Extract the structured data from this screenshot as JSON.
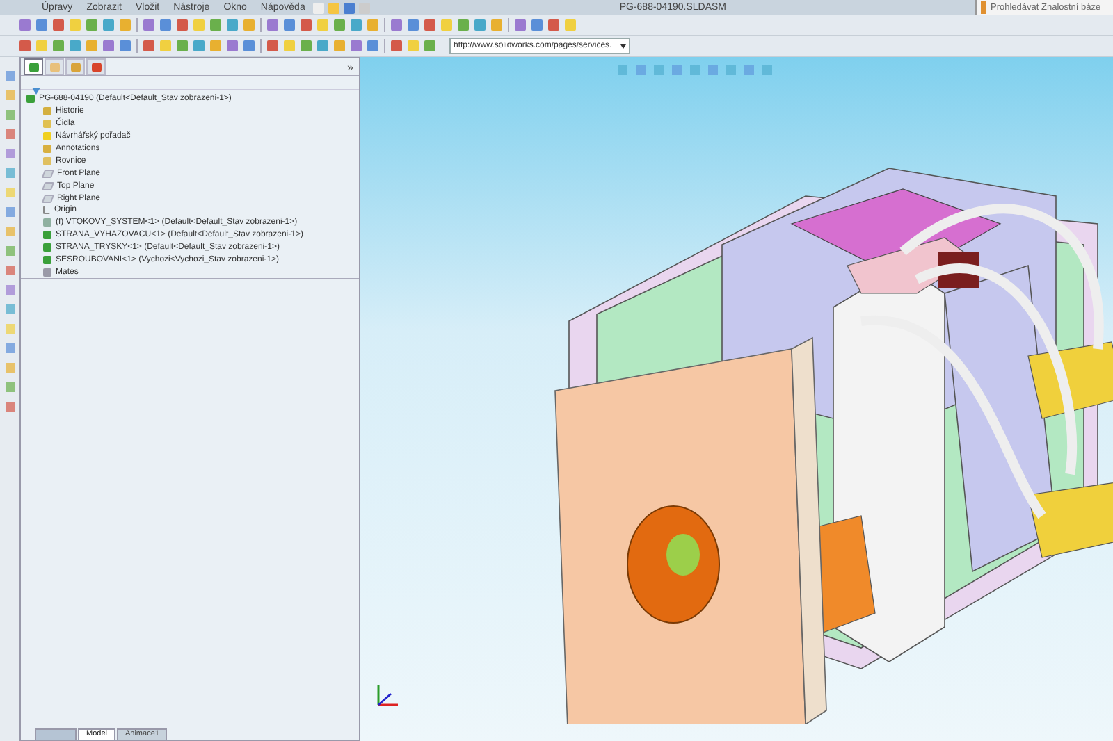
{
  "menu_bar": [
    "Úpravy",
    "Zobrazit",
    "Vložit",
    "Nástroje",
    "Okno",
    "Nápověda"
  ],
  "window": {
    "title": "PG-688-04190.SLDASM"
  },
  "search": {
    "placeholder": "Prohledávat Znalostní báze"
  },
  "address_bar": {
    "value": "http://www.solidworks.com/pages/services."
  },
  "panel_tabs": [
    {
      "kind": "feature",
      "selected": true
    },
    {
      "kind": "property",
      "selected": false
    },
    {
      "kind": "config",
      "selected": false
    },
    {
      "kind": "appearance",
      "selected": false
    }
  ],
  "panel_collapse": "»",
  "tree": {
    "label": "PG-688-04190  (Default<Default_Stav zobrazeni-1>)",
    "kind": "assembly",
    "children": [
      {
        "label": "Historie",
        "kind": "history"
      },
      {
        "label": "Čidla",
        "kind": "sensor"
      },
      {
        "label": "Návrhářský pořadač",
        "kind": "bulb"
      },
      {
        "label": "Annotations",
        "kind": "annotation"
      },
      {
        "label": "Rovnice",
        "kind": "equation"
      },
      {
        "label": "Front Plane",
        "kind": "plane"
      },
      {
        "label": "Top Plane",
        "kind": "plane"
      },
      {
        "label": "Right Plane",
        "kind": "plane"
      },
      {
        "label": "Origin",
        "kind": "origin"
      },
      {
        "label": "(f) VTOKOVY_SYSTEM<1> (Default<Default_Stav zobrazeni-1>)",
        "kind": "subassembly"
      },
      {
        "label": "STRANA_VYHAZOVACU<1> (Default<Default_Stav zobrazeni-1>)",
        "kind": "assembly"
      },
      {
        "label": "STRANA_TRYSKY<1> (Default<Default_Stav zobrazeni-1>)",
        "kind": "assembly"
      },
      {
        "label": "SESROUBOVANI<1> (Vychozi<Vychozi_Stav zobrazeni-1>)",
        "kind": "assembly"
      },
      {
        "label": "Mates",
        "kind": "mates"
      }
    ]
  },
  "bottom_tabs": [
    {
      "label": "Model",
      "selected": true
    },
    {
      "label": "Animace1",
      "selected": false
    }
  ]
}
